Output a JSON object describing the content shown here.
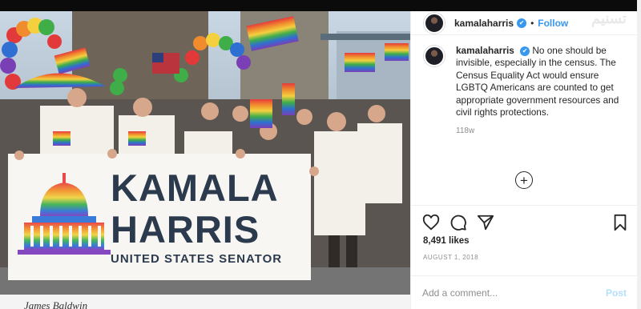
{
  "post": {
    "username": "kamalaharris",
    "follow_label": "Follow",
    "dot": "•",
    "verified_icon": "✔",
    "caption_text": "No one should be invisible, especially in the census. The Census Equality Act would ensure LGBTQ Americans are counted to get appropriate government resources and civil rights protections.",
    "time_ago": "118w",
    "likes": "8,491 likes",
    "date": "AUGUST 1, 2018",
    "add_comment_placeholder": "Add a comment...",
    "post_label": "Post",
    "plus": "+"
  },
  "photo": {
    "banner_line1": "KAMALA",
    "banner_line2": "HARRIS",
    "banner_line3": "UNITED STATES SENATOR",
    "bottom_caption": "James Baldwin"
  },
  "watermark": {
    "text": "تسنیم"
  },
  "icons": {
    "like": "heart-icon",
    "comment": "comment-icon",
    "share": "send-icon",
    "save": "bookmark-icon",
    "more": "more-icon"
  },
  "colors": {
    "accent": "#3897f0",
    "post_disabled": "#b2dffc",
    "muted": "#8e8e8e",
    "banner_text": "#2c3a4e"
  }
}
